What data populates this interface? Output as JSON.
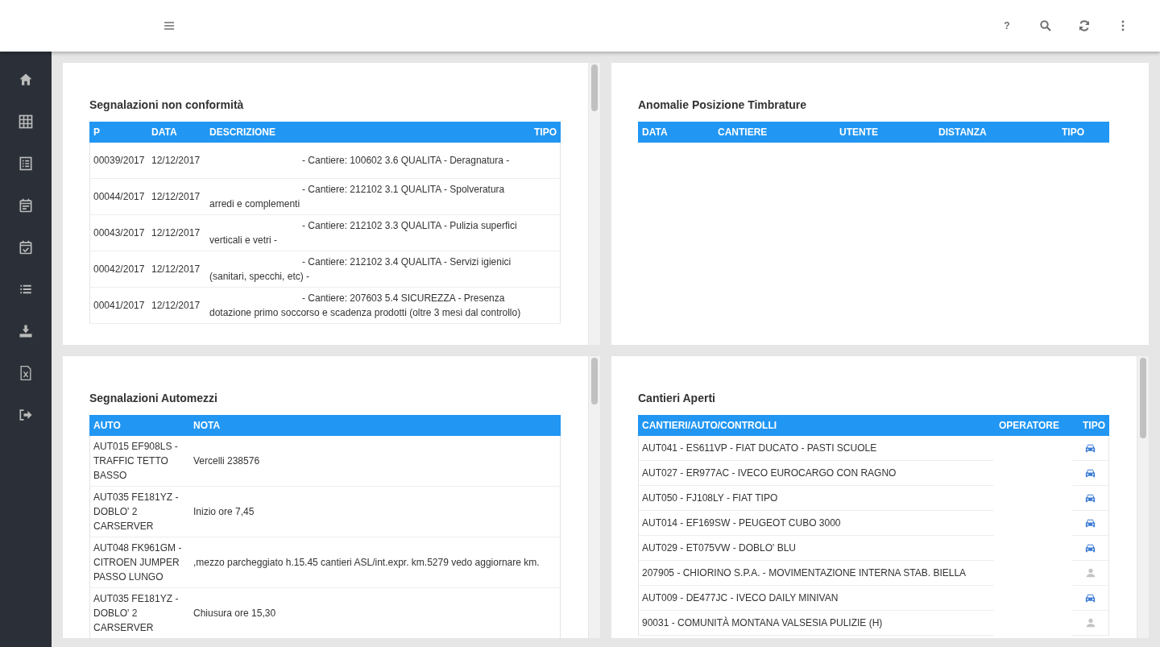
{
  "topbar": {
    "help": "?"
  },
  "panels": [
    {
      "kind": "nc",
      "title": "Segnalazioni non conformità",
      "columns": [
        "P",
        "DATA",
        "DESCRIZIONE",
        "TIPO"
      ],
      "rows": [
        {
          "cells": [
            "00039/2017",
            "12/12/2017",
            "- Cantiere: 100602 3.6 QUALITA - Deragnatura -"
          ]
        },
        {
          "cells": [
            "00044/2017",
            "12/12/2017",
            "- Cantiere: 212102 3.1 QUALITA - Spolveratura arredi e complementi"
          ]
        },
        {
          "cells": [
            "00043/2017",
            "12/12/2017",
            "- Cantiere: 212102 3.3 QUALITA - Pulizia superfici verticali e vetri -"
          ]
        },
        {
          "cells": [
            "00042/2017",
            "12/12/2017",
            "- Cantiere: 212102 3.4 QUALITA - Servizi igienici (sanitari, specchi, etc) -"
          ]
        },
        {
          "cells": [
            "00041/2017",
            "12/12/2017",
            "- Cantiere: 207603 5.4 SICUREZZA - Presenza dotazione primo soccorso e scadenza prodotti (oltre 3 mesi dal controllo)"
          ]
        }
      ]
    },
    {
      "kind": "anomalie",
      "title": "Anomalie Posizione Timbrature",
      "columns": [
        "DATA",
        "CANTIERE",
        "UTENTE",
        "DISTANZA",
        "TIPO"
      ]
    },
    {
      "kind": "auto",
      "title": "Segnalazioni Automezzi",
      "columns": [
        "AUTO",
        "NOTA"
      ],
      "rows": [
        {
          "cells": [
            "AUT015 EF908LS - TRAFFIC TETTO BASSO",
            "Vercelli 238576"
          ]
        },
        {
          "cells": [
            "AUT035 FE181YZ - DOBLO' 2 CARSERVER",
            "Inizio ore 7,45"
          ]
        },
        {
          "cells": [
            "AUT048 FK961GM - CITROEN JUMPER PASSO LUNGO",
            ",mezzo parcheggiato h.15.45 cantieri ASL/int.expr. km.5279 vedo aggiornare km."
          ]
        },
        {
          "cells": [
            "AUT035 FE181YZ - DOBLO' 2 CARSERVER",
            "Chiusura ore 15,30"
          ]
        }
      ]
    },
    {
      "kind": "cantieri",
      "title": "Cantieri Aperti",
      "columns": [
        "CANTIERI/AUTO/CONTROLLI",
        "OPERATORE",
        "TIPO"
      ],
      "rows": [
        {
          "cells": [
            "AUT041 - ES611VP - FIAT DUCATO - PASTI SCUOLE"
          ],
          "kind": "car"
        },
        {
          "cells": [
            "AUT027 - ER977AC - IVECO EUROCARGO CON RAGNO"
          ],
          "kind": "car"
        },
        {
          "cells": [
            "AUT050 - FJ108LY - FIAT TIPO"
          ],
          "kind": "car"
        },
        {
          "cells": [
            "AUT014 - EF169SW - PEUGEOT CUBO 3000"
          ],
          "kind": "car"
        },
        {
          "cells": [
            "AUT029 - ET075VW - DOBLO' BLU"
          ],
          "kind": "car"
        },
        {
          "cells": [
            "207905 - CHIORINO S.P.A. - MOVIMENTAZIONE INTERNA STAB. BIELLA"
          ],
          "kind": "person"
        },
        {
          "cells": [
            "AUT009 - DE477JC - IVECO DAILY MINIVAN"
          ],
          "kind": "car"
        },
        {
          "cells": [
            "90031 - COMUNITÀ MONTANA VALSESIA PULIZIE (H)"
          ],
          "kind": "person"
        }
      ]
    }
  ]
}
